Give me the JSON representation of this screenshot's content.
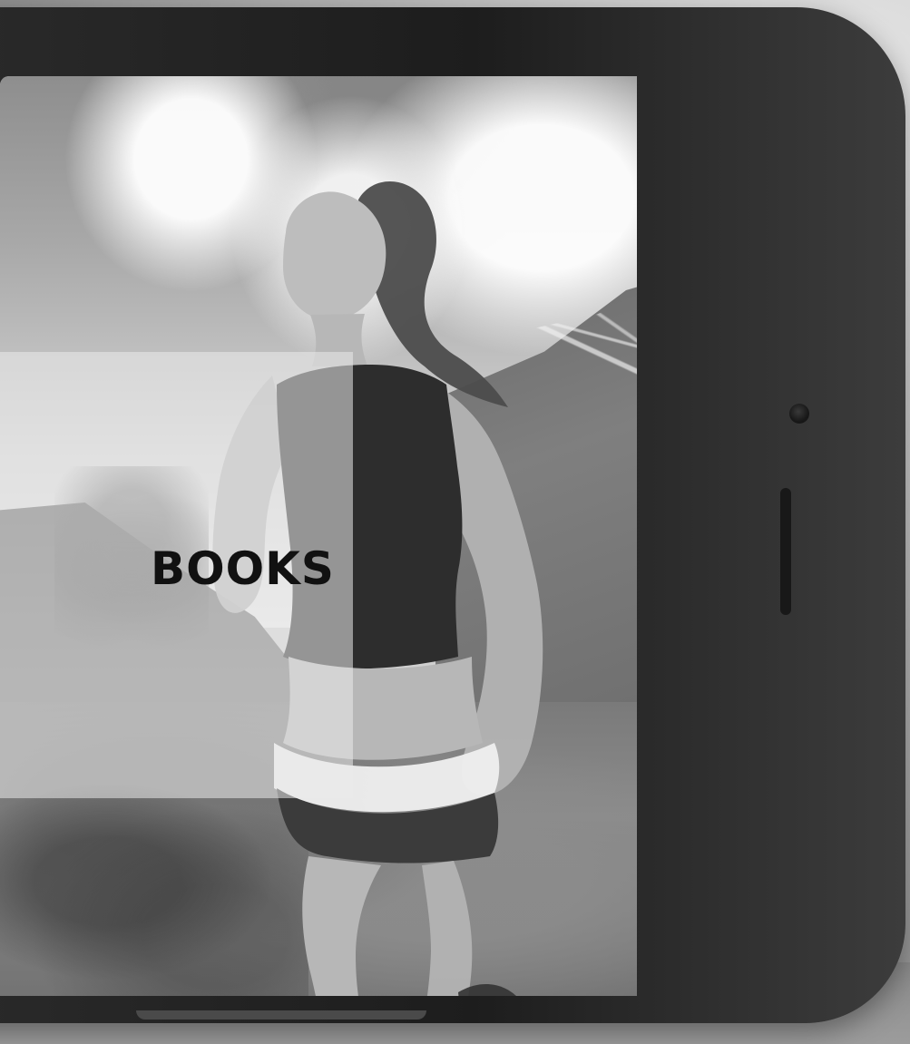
{
  "hero": {
    "title": "BOOKS"
  },
  "theme": {
    "text_color": "#111111",
    "panel_color": "rgba(235,235,235,0.55)"
  }
}
